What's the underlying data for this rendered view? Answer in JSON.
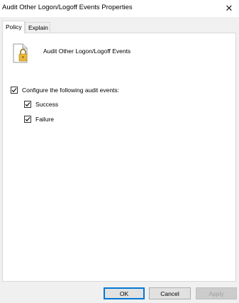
{
  "window": {
    "title": "Audit Other Logon/Logoff Events Properties",
    "close_glyph": "✕"
  },
  "tabs": [
    {
      "label": "Policy",
      "active": true
    },
    {
      "label": "Explain",
      "active": false
    }
  ],
  "policy": {
    "name": "Audit Other Logon/Logoff Events",
    "icon": "document-lock-icon"
  },
  "configure": {
    "label": "Configure the following audit events:",
    "checked": true,
    "options": [
      {
        "label": "Success",
        "checked": true
      },
      {
        "label": "Failure",
        "checked": true
      }
    ]
  },
  "buttons": {
    "ok": "OK",
    "cancel": "Cancel",
    "apply": "Apply"
  },
  "colors": {
    "default_button_border": "#0078d7",
    "panel_bg": "#ffffff",
    "dialog_bg": "#f0f0f0",
    "lock": "#e8b83a"
  }
}
